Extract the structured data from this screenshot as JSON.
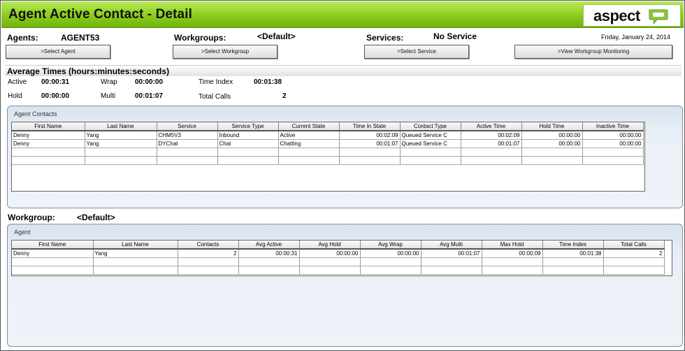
{
  "header": {
    "title": "Agent Active Contact - Detail",
    "logo_text": "aspect"
  },
  "filters": {
    "agents_label": "Agents:",
    "agents_value": "AGENT53",
    "workgroups_label": "Workgroups:",
    "workgroups_value": "<Default>",
    "services_label": "Services:",
    "services_value": "No Service",
    "date": "Friday, January 24, 2014"
  },
  "buttons": {
    "select_agent": ">Select Agent",
    "select_workgroup": ">Select Workgroup",
    "select_service": ">Select Service",
    "view_monitoring": ">View Workgroup Monitoring"
  },
  "averages": {
    "title": "Average Times (hours:minutes:seconds)",
    "active_label": "Active",
    "active_value": "00:00:31",
    "wrap_label": "Wrap",
    "wrap_value": "00:00:00",
    "time_index_label": "Time Index",
    "time_index_value": "00:01:38",
    "hold_label": "Hold",
    "hold_value": "00:00:00",
    "multi_label": "Multi",
    "multi_value": "00:01:07",
    "total_calls_label": "Total Calls",
    "total_calls_value": "2"
  },
  "agent_contacts": {
    "title": "Agent Contacts",
    "columns": [
      "First Name",
      "Last Name",
      "Service",
      "Service Type",
      "Current State",
      "Time In State",
      "Contact Type",
      "Active Time",
      "Hold Time",
      "Inactive Time"
    ],
    "rows": [
      [
        "Denny",
        "Yang",
        "CHM5V3",
        "Inbound",
        "Active",
        "00:02:09",
        "Queued Service C",
        "00:02:09",
        "00:00:00",
        "00:00:00"
      ],
      [
        "Denny",
        "Yang",
        "DYChat",
        "Chat",
        "Chatting",
        "00:01:07",
        "Queued Service C",
        "00:01:07",
        "00:00:00",
        "00:00:00"
      ]
    ]
  },
  "workgroup": {
    "label": "Workgroup:",
    "value": "<Default>",
    "panel_title": "Agent",
    "columns": [
      "First Name",
      "Last Name",
      "Contacts",
      "Avg Active",
      "Avg Hold",
      "Avg Wrap",
      "Avg Multi",
      "Max Hold",
      "Time Index",
      "Total Calls"
    ],
    "rows": [
      [
        "Denny",
        "Yang",
        "2",
        "00:00:31",
        "00:00:00",
        "00:00:00",
        "00:01:07",
        "00:00:09",
        "00:01:38",
        "2"
      ]
    ]
  },
  "colors": {
    "title_green": "#8ccc1c",
    "logo_bubble": "#8cc63f",
    "panel_border": "#7d8fa6"
  }
}
